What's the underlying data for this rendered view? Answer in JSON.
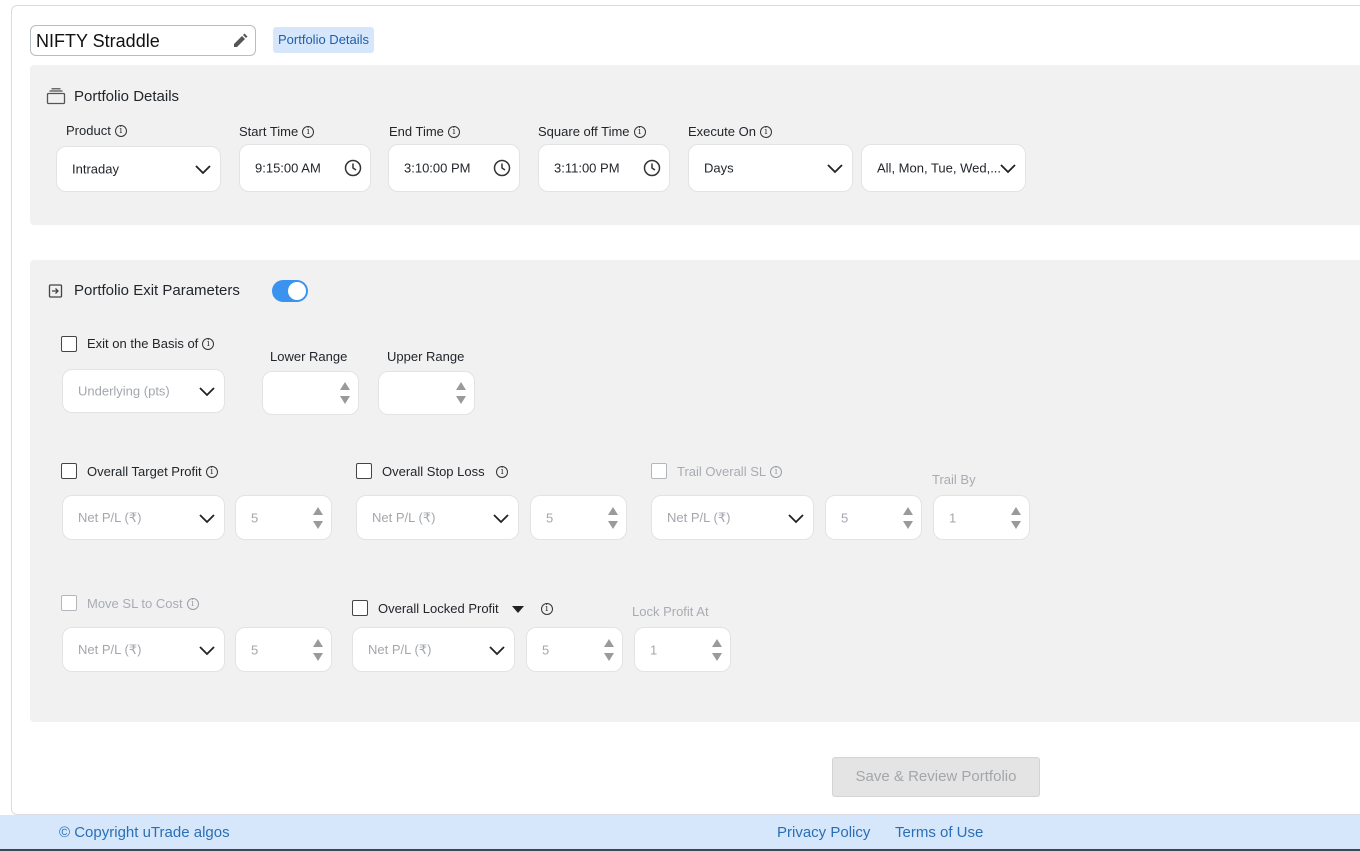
{
  "portfolio_name": "NIFTY Straddle",
  "tag": "Portfolio Details",
  "details": {
    "title": "Portfolio Details",
    "product": {
      "label": "Product",
      "value": "Intraday"
    },
    "start_time": {
      "label": "Start Time",
      "value": "9:15:00 AM"
    },
    "end_time": {
      "label": "End Time",
      "value": "3:10:00 PM"
    },
    "square_off": {
      "label": "Square off Time",
      "value": "3:11:00 PM"
    },
    "execute_on": {
      "label": "Execute On",
      "value": "Days",
      "days": "All, Mon, Tue, Wed,..."
    }
  },
  "exit": {
    "title": "Portfolio Exit Parameters",
    "toggle_on": true,
    "basis": {
      "label": "Exit on the Basis of",
      "value": "Underlying (pts)",
      "lower_label": "Lower Range",
      "upper_label": "Upper Range"
    },
    "target": {
      "label": "Overall Target Profit",
      "type": "Net P/L (₹)",
      "value": "5"
    },
    "stop_loss": {
      "label": "Overall Stop Loss",
      "type": "Net P/L (₹)",
      "value": "5"
    },
    "trail": {
      "label": "Trail Overall SL",
      "type": "Net P/L (₹)",
      "value": "5",
      "trail_by_label": "Trail By",
      "trail_by": "1"
    },
    "move_sl": {
      "label": "Move SL to Cost",
      "type": "Net P/L (₹)",
      "value": "5"
    },
    "locked": {
      "label": "Overall Locked Profit",
      "type": "Net P/L (₹)",
      "value": "5",
      "lock_at_label": "Lock Profit At",
      "lock_at": "1"
    }
  },
  "save_button": "Save & Review Portfolio",
  "footer": {
    "copyright": "© Copyright uTrade algos",
    "privacy": "Privacy Policy",
    "terms": "Terms of Use"
  },
  "colors": {
    "accent": "#3b93f0",
    "tag_bg": "#d6e7fb",
    "panel_bg": "#f1f1f1"
  }
}
